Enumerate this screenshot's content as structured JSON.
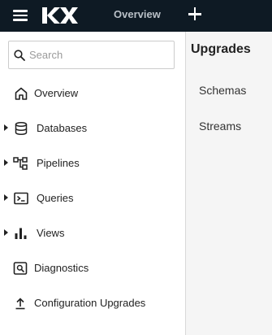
{
  "topbar": {
    "logo_text": "KX",
    "active_tab": "Overview",
    "icons": [
      "hamburger-menu-icon",
      "kx-logo",
      "plus-icon"
    ]
  },
  "sidebar": {
    "search": {
      "placeholder": "Search",
      "value": "",
      "icon": "search-icon"
    },
    "items": [
      {
        "label": "Overview",
        "icon": "home-icon",
        "expandable": false
      },
      {
        "label": "Databases",
        "icon": "database-icon",
        "expandable": true
      },
      {
        "label": "Pipelines",
        "icon": "pipeline-icon",
        "expandable": true
      },
      {
        "label": "Queries",
        "icon": "terminal-icon",
        "expandable": true
      },
      {
        "label": "Views",
        "icon": "bar-chart-icon",
        "expandable": true
      },
      {
        "label": "Diagnostics",
        "icon": "diagnostics-icon",
        "expandable": false
      },
      {
        "label": "Configuration Upgrades",
        "icon": "upload-icon",
        "expandable": false
      }
    ]
  },
  "main": {
    "title": "Upgrades",
    "links": [
      "Schemas",
      "Streams"
    ]
  },
  "colors": {
    "topbar_bg": "#0e1a24",
    "main_bg": "#f5f5f5",
    "sidebar_bg": "#ffffff"
  }
}
